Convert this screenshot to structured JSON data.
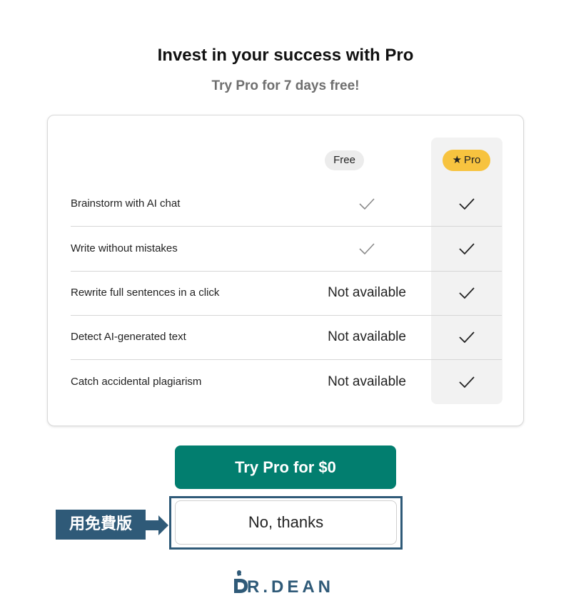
{
  "header": {
    "title": "Invest in your success with Pro",
    "subtitle": "Try Pro for 7 days free!"
  },
  "plans": {
    "free_label": "Free",
    "pro_label": "Pro"
  },
  "features": [
    {
      "name": "Brainstorm with AI chat",
      "free": "check",
      "pro": "check"
    },
    {
      "name": "Write without mistakes",
      "free": "check",
      "pro": "check"
    },
    {
      "name": "Rewrite full sentences in a click",
      "free": "Not available",
      "pro": "check"
    },
    {
      "name": "Detect AI-generated text",
      "free": "Not available",
      "pro": "check"
    },
    {
      "name": "Catch accidental plagiarism",
      "free": "Not available",
      "pro": "check"
    }
  ],
  "actions": {
    "primary_label": "Try Pro for $0",
    "secondary_label": "No, thanks"
  },
  "annotation": {
    "label": "用免費版"
  },
  "logo": {
    "text": "R.DEAN"
  },
  "colors": {
    "primary": "#027e6f",
    "pro_badge": "#f7c33f",
    "annotation": "#2f5a78"
  }
}
